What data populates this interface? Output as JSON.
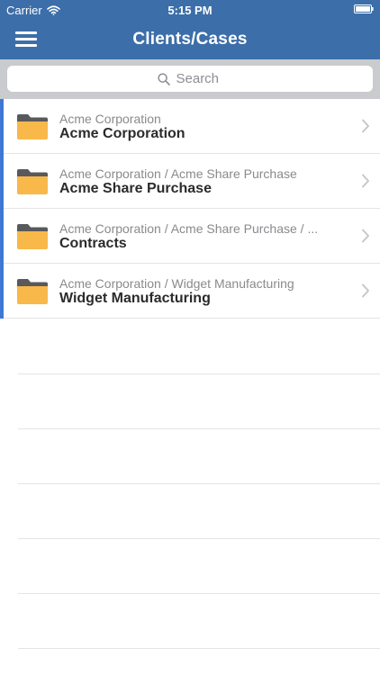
{
  "status_bar": {
    "carrier": "Carrier",
    "time": "5:15 PM"
  },
  "nav": {
    "title": "Clients/Cases",
    "menu_icon": "hamburger-menu-icon"
  },
  "search": {
    "placeholder": "Search",
    "icon": "search-icon"
  },
  "colors": {
    "header": "#3c6ea9",
    "search_band": "#c9cbcf",
    "row_marker": "#3f77d4",
    "folder": "#f8b84a",
    "folder_tab": "#58595b"
  },
  "cases": [
    {
      "path": "Acme Corporation",
      "title": "Acme Corporation",
      "icon": "folder-icon"
    },
    {
      "path": "Acme Corporation / Acme Share Purchase",
      "title": "Acme Share Purchase",
      "icon": "folder-icon"
    },
    {
      "path": "Acme Corporation / Acme Share Purchase / ...",
      "title": "Contracts",
      "icon": "folder-icon"
    },
    {
      "path": "Acme Corporation / Widget Manufacturing",
      "title": "Widget Manufacturing",
      "icon": "folder-icon"
    }
  ]
}
